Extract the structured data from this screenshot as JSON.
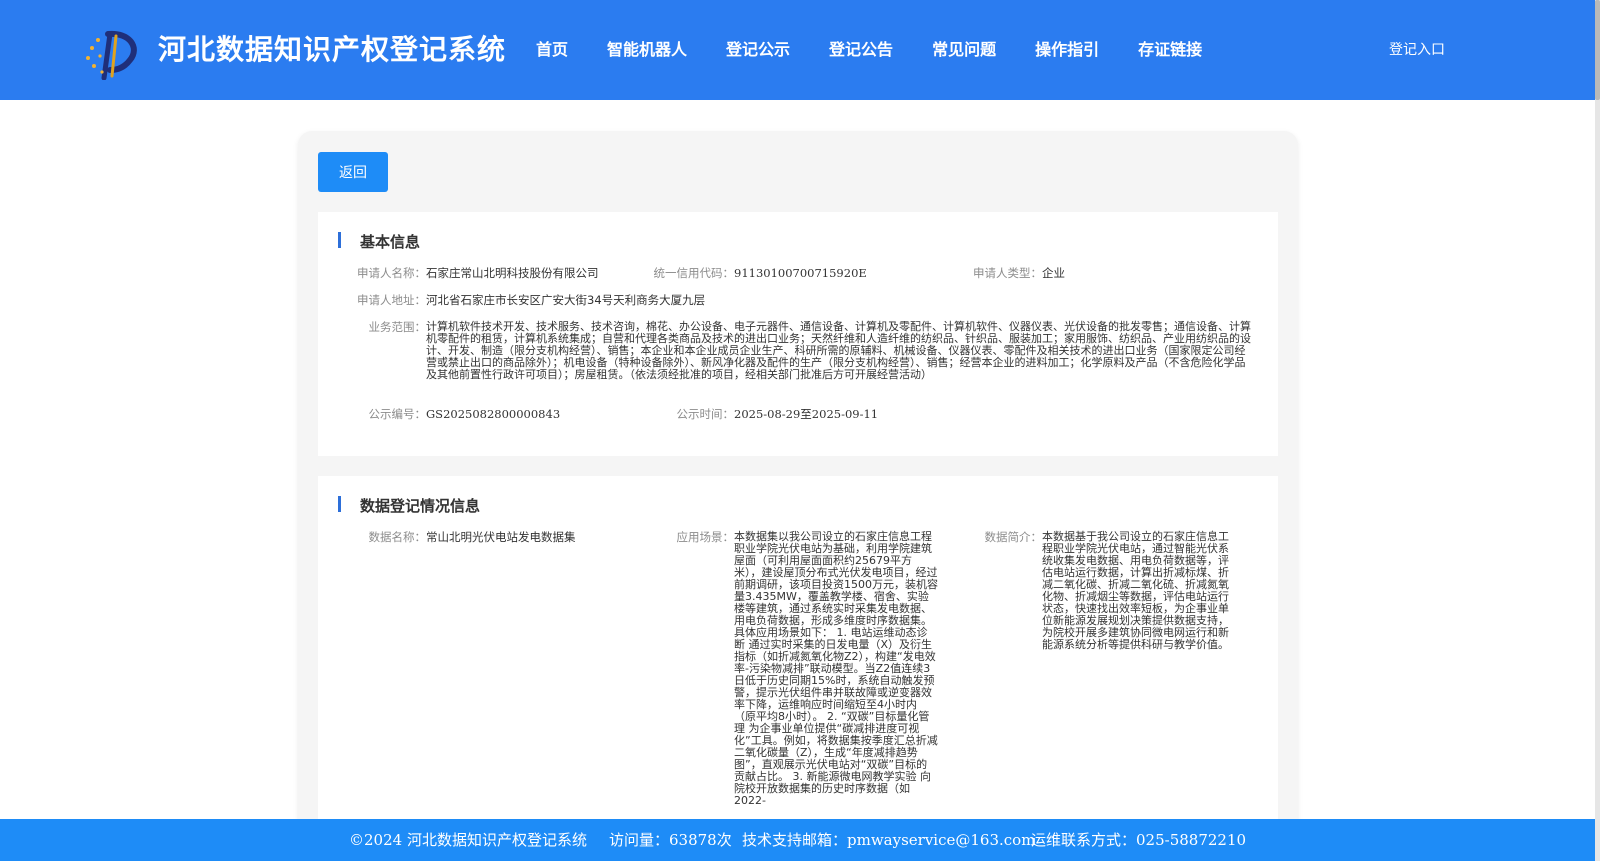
{
  "header": {
    "site_title": "河北数据知识产权登记系统",
    "nav": [
      "首页",
      "智能机器人",
      "登记公示",
      "登记公告",
      "常见问题",
      "操作指引",
      "存证链接"
    ],
    "login_label": "登记入口"
  },
  "toolbar": {
    "back_label": "返回"
  },
  "basic": {
    "title": "基本信息",
    "applicant_name_label": "申请人名称：",
    "applicant_name": "石家庄常山北明科技股份有限公司",
    "credit_code_label": "统一信用代码：",
    "credit_code": "91130100700715920E",
    "applicant_type_label": "申请人类型：",
    "applicant_type": "企业",
    "address_label": "申请人地址：",
    "address": "河北省石家庄市长安区广安大街34号天利商务大厦九层",
    "scope_label": "业务范围：",
    "scope": "计算机软件技术开发、技术服务、技术咨询，棉花、办公设备、电子元器件、通信设备、计算机及零配件、计算机软件、仪器仪表、光伏设备的批发零售；通信设备、计算机零配件的租赁，计算机系统集成；自营和代理各类商品及技术的进出口业务；天然纤维和人造纤维的纺织品、针织品、服装加工；家用服饰、纺织品、产业用纺织品的设计、开发、制造（限分支机构经营）、销售；本企业和本企业成员企业生产、科研所需的原辅料、机械设备、仪器仪表、零配件及相关技术的进出口业务（国家限定公司经营或禁止出口的商品除外）；机电设备（特种设备除外）、新风净化器及配件的生产（限分支机构经营）、销售；经营本企业的进料加工；化学原料及产品（不含危险化学品及其他前置性行政许可项目）；房屋租赁。（依法须经批准的项目，经相关部门批准后方可开展经营活动）",
    "pub_no_label": "公示编号：",
    "pub_no": "GS2025082800000843",
    "pub_time_label": "公示时间：",
    "pub_time": "2025-08-29至2025-09-11"
  },
  "data_info": {
    "title": "数据登记情况信息",
    "name_label": "数据名称：",
    "name": "常山北明光伏电站发电数据集",
    "scene_label": "应用场景：",
    "scene": "本数据集以我公司设立的石家庄信息工程职业学院光伏电站为基础，利用学院建筑屋面（可利用屋面面积约25679平方米），建设屋顶分布式光伏发电项目，经过前期调研，该项目投资1500万元，装机容量3.435MW，覆盖教学楼、宿舍、实验楼等建筑，通过系统实时采集发电数据、用电负荷数据，形成多维度时序数据集。具体应用场景如下： 1. 电站运维动态诊断 通过实时采集的日发电量（X）及衍生指标（如折减氮氧化物Z2），构建“发电效率-污染物减排”联动模型。当Z2值连续3日低于历史同期15%时，系统自动触发预警，提示光伏组件串并联故障或逆变器效率下降，运维响应时间缩短至4小时内（原平均8小时）。 2. “双碳”目标量化管理 为企事业单位提供“碳减排进度可视化”工具。例如，将数据集按季度汇总折减二氧化碳量（Z），生成“年度减排趋势图”，直观展示光伏电站对“双碳”目标的贡献占比。 3. 新能源微电网教学实验 向院校开放数据集的历史时序数据（如2022-",
    "intro_label": "数据简介：",
    "intro": "本数据基于我公司设立的石家庄信息工程职业学院光伏电站，通过智能光伏系统收集发电数据、用电负荷数据等，评估电站运行数据，计算出折减标煤、折减二氧化碳、折减二氧化硫、折减氮氧化物、折减烟尘等数据，评估电站运行状态，快速找出效率短板，为企事业单位新能源发展规划决策提供数据支持，为院校开展多建筑协同微电网运行和新能源系统分析等提供科研与教学价值。"
  },
  "footer": {
    "copyright": "©2024 河北数据知识产权登记系统",
    "visits": "访问量：63878次",
    "email": "技术支持邮箱：pmwayservice@163.com",
    "phone": "运维联系方式：025-58872210"
  },
  "colors": {
    "primary": "#2b7cf0",
    "button": "#1e8cf7",
    "accent_bar": "#2d6fd9"
  }
}
